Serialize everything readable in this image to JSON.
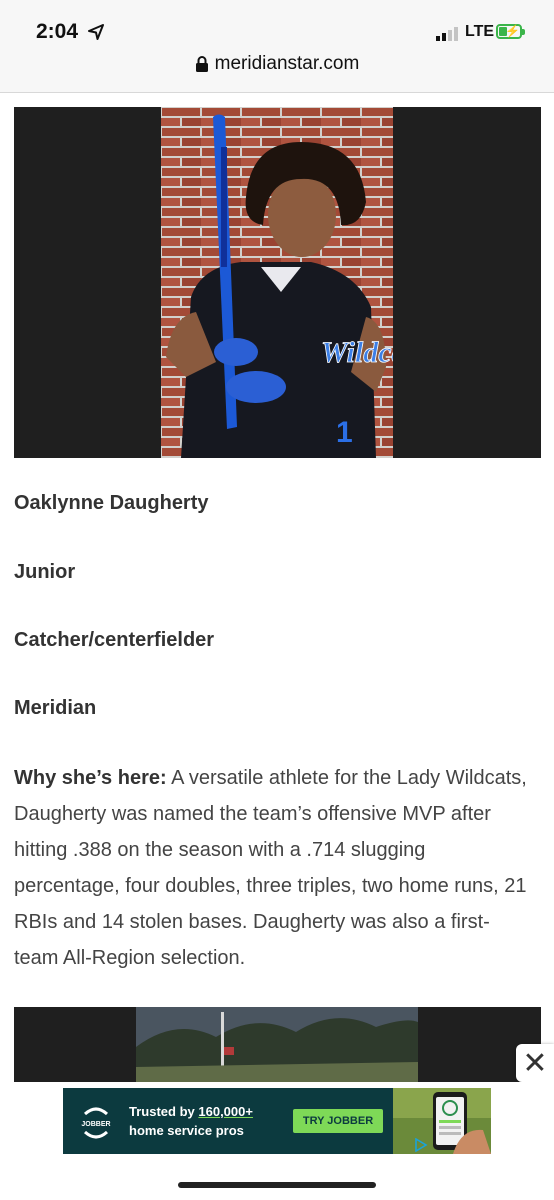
{
  "status_bar": {
    "time": "2:04",
    "network": "LTE"
  },
  "browser": {
    "url": "meridianstar.com"
  },
  "article": {
    "name": "Oaklynne Daugherty",
    "grade": "Junior",
    "position": "Catcher/centerfielder",
    "school": "Meridian",
    "why_label": "Why she’s here:",
    "why_text": "A versatile athlete for the Lady Wildcats, Daugherty was named the team’s offensive MVP after hitting .388 on the season with a .714 slugging percentage, four doubles, three triples, two home runs, 21 RBIs and 14 stolen bases. Daugherty was also a first-team All-Region selection.",
    "jersey_text": "Wildcats"
  },
  "ad": {
    "logo_text": "JOBBER",
    "line1_prefix": "Trusted by",
    "line1_highlight": "160,000+",
    "line2": "home service pros",
    "cta": "TRY JOBBER",
    "close_symbol": "✕"
  },
  "colors": {
    "battery": "#3bb54a",
    "ad_bg": "#0c3a3f",
    "ad_accent": "#7ed957"
  }
}
